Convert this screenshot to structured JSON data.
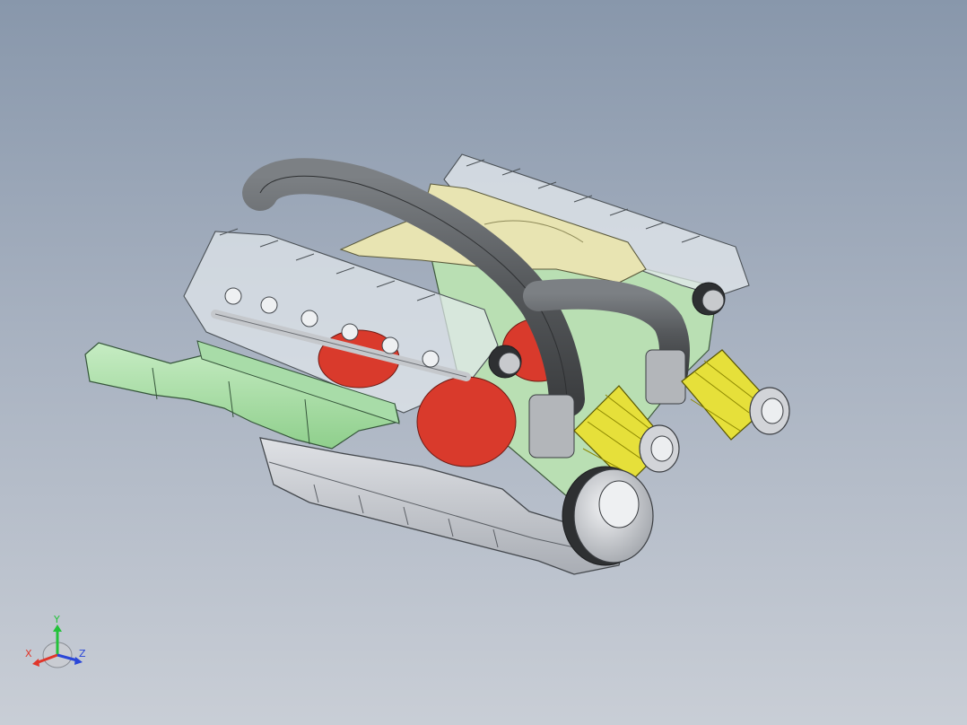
{
  "viewport": {
    "background_top": "#8897ab",
    "background_bottom": "#c9ced6"
  },
  "model": {
    "part_colors": {
      "intake_tube": "#5a5d60",
      "manifold": "#e8e4b2",
      "exhaust": "#a8dca8",
      "transparent_head": "#e4eaee",
      "internals": "#d93a2c",
      "air_filter": "#e6e03a",
      "oil_pan": "#c9ccd1",
      "pulley": "#d6d8dc"
    }
  },
  "triad": {
    "y_label": "Y",
    "x_label": "X",
    "z_label": "Z",
    "y_color": "#23c23a",
    "x_color": "#e0362a",
    "z_color": "#2a47d8"
  }
}
